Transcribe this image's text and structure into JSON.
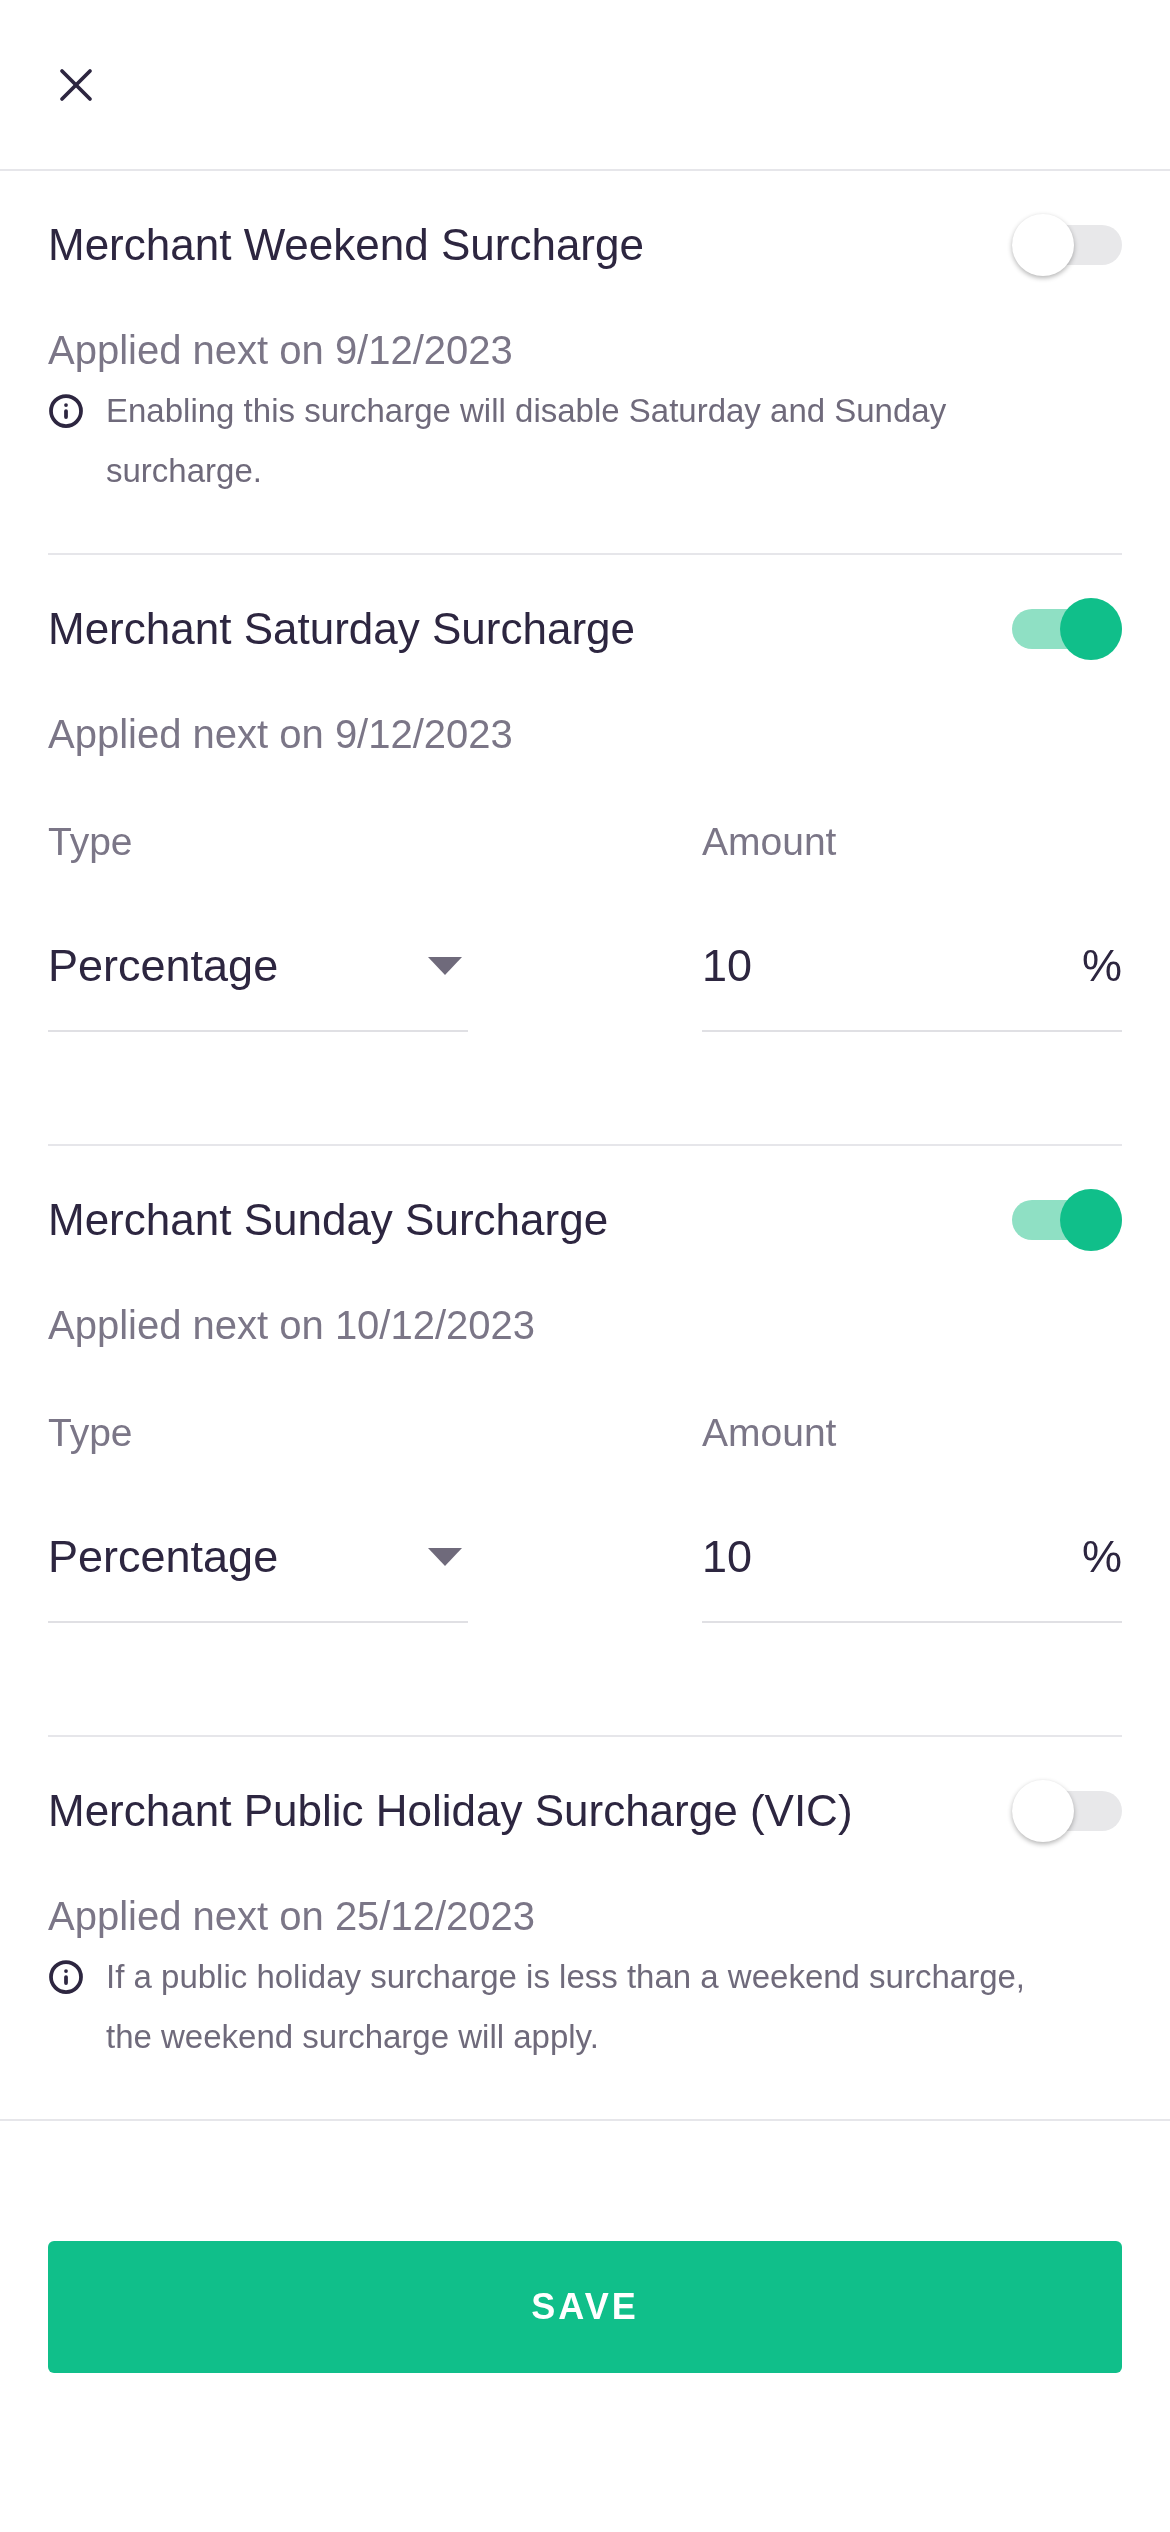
{
  "surcharges": [
    {
      "title": "Merchant Weekend Surcharge",
      "on": false,
      "applied": "Applied next on 9/12/2023",
      "info": "Enabling this surcharge will disable Saturday and Sunday surcharge."
    },
    {
      "title": "Merchant Saturday Surcharge",
      "on": true,
      "applied": "Applied next on 9/12/2023",
      "fields": {
        "type_label": "Type",
        "type_value": "Percentage",
        "amount_label": "Amount",
        "amount_value": "10",
        "unit": "%"
      }
    },
    {
      "title": "Merchant Sunday Surcharge",
      "on": true,
      "applied": "Applied next on 10/12/2023",
      "fields": {
        "type_label": "Type",
        "type_value": "Percentage",
        "amount_label": "Amount",
        "amount_value": "10",
        "unit": "%"
      }
    },
    {
      "title": "Merchant Public Holiday Surcharge (VIC)",
      "on": false,
      "applied": "Applied next on 25/12/2023",
      "info": "If a public holiday surcharge is less than a weekend surcharge, the weekend surcharge will apply."
    }
  ],
  "save_button": "SAVE"
}
